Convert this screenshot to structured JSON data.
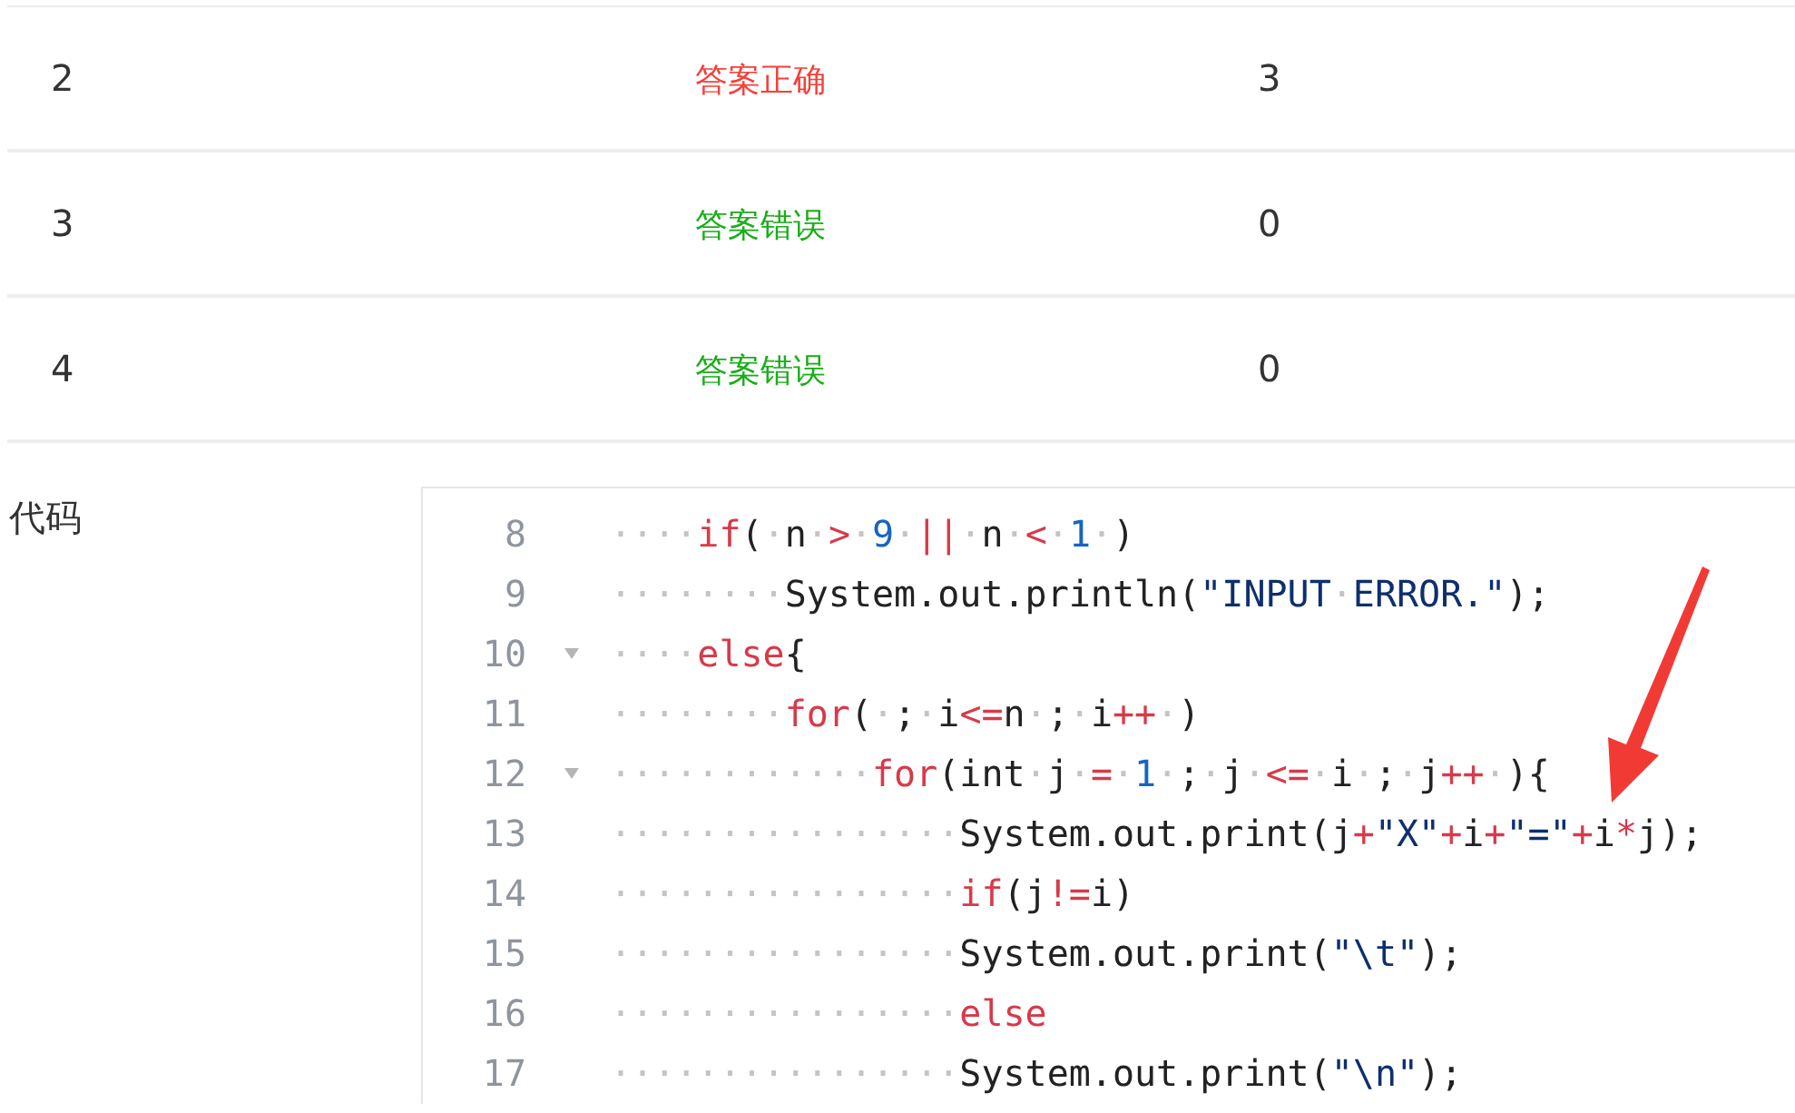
{
  "results": [
    {
      "number": "2",
      "result": "答案正确",
      "color": "#f5403a",
      "score": "3"
    },
    {
      "number": "3",
      "result": "答案错误",
      "color": "#1aad19",
      "score": "0"
    },
    {
      "number": "4",
      "result": "答案错误",
      "color": "#1aad19",
      "score": "0"
    }
  ],
  "code_label": "代码",
  "code_lines": [
    {
      "number": "8",
      "foldable": false,
      "tokens": [
        {
          "text": "····",
          "kind": "whitespace"
        },
        {
          "text": "if",
          "kind": "keyword"
        },
        {
          "text": "(",
          "kind": "plain"
        },
        {
          "text": "·",
          "kind": "whitespace"
        },
        {
          "text": "n",
          "kind": "plain"
        },
        {
          "text": "·",
          "kind": "whitespace"
        },
        {
          "text": ">",
          "kind": "operator"
        },
        {
          "text": "·",
          "kind": "whitespace"
        },
        {
          "text": "9",
          "kind": "number"
        },
        {
          "text": "·",
          "kind": "whitespace"
        },
        {
          "text": "||",
          "kind": "operator"
        },
        {
          "text": "·",
          "kind": "whitespace"
        },
        {
          "text": "n",
          "kind": "plain"
        },
        {
          "text": "·",
          "kind": "whitespace"
        },
        {
          "text": "<",
          "kind": "operator"
        },
        {
          "text": "·",
          "kind": "whitespace"
        },
        {
          "text": "1",
          "kind": "number"
        },
        {
          "text": "·",
          "kind": "whitespace"
        },
        {
          "text": ")",
          "kind": "plain"
        }
      ]
    },
    {
      "number": "9",
      "foldable": false,
      "tokens": [
        {
          "text": "········",
          "kind": "whitespace"
        },
        {
          "text": "System.out.println(",
          "kind": "plain"
        },
        {
          "text": "\"INPUT",
          "kind": "string"
        },
        {
          "text": "·",
          "kind": "whitespace"
        },
        {
          "text": "ERROR.\"",
          "kind": "string"
        },
        {
          "text": ");",
          "kind": "plain"
        }
      ]
    },
    {
      "number": "10",
      "foldable": true,
      "tokens": [
        {
          "text": "····",
          "kind": "whitespace"
        },
        {
          "text": "else",
          "kind": "keyword"
        },
        {
          "text": "{",
          "kind": "plain"
        }
      ]
    },
    {
      "number": "11",
      "foldable": false,
      "tokens": [
        {
          "text": "········",
          "kind": "whitespace"
        },
        {
          "text": "for",
          "kind": "keyword"
        },
        {
          "text": "(",
          "kind": "plain"
        },
        {
          "text": "·",
          "kind": "whitespace"
        },
        {
          "text": ";",
          "kind": "plain"
        },
        {
          "text": "·",
          "kind": "whitespace"
        },
        {
          "text": "i",
          "kind": "plain"
        },
        {
          "text": "<=",
          "kind": "operator"
        },
        {
          "text": "n",
          "kind": "plain"
        },
        {
          "text": "·",
          "kind": "whitespace"
        },
        {
          "text": ";",
          "kind": "plain"
        },
        {
          "text": "·",
          "kind": "whitespace"
        },
        {
          "text": "i",
          "kind": "plain"
        },
        {
          "text": "++",
          "kind": "operator"
        },
        {
          "text": "·",
          "kind": "whitespace"
        },
        {
          "text": ")",
          "kind": "plain"
        }
      ]
    },
    {
      "number": "12",
      "foldable": true,
      "tokens": [
        {
          "text": "············",
          "kind": "whitespace"
        },
        {
          "text": "for",
          "kind": "keyword"
        },
        {
          "text": "(int",
          "kind": "plain"
        },
        {
          "text": "·",
          "kind": "whitespace"
        },
        {
          "text": "j",
          "kind": "plain"
        },
        {
          "text": "·",
          "kind": "whitespace"
        },
        {
          "text": "=",
          "kind": "operator"
        },
        {
          "text": "·",
          "kind": "whitespace"
        },
        {
          "text": "1",
          "kind": "number"
        },
        {
          "text": "·",
          "kind": "whitespace"
        },
        {
          "text": ";",
          "kind": "plain"
        },
        {
          "text": "·",
          "kind": "whitespace"
        },
        {
          "text": "j",
          "kind": "plain"
        },
        {
          "text": "·",
          "kind": "whitespace"
        },
        {
          "text": "<=",
          "kind": "operator"
        },
        {
          "text": "·",
          "kind": "whitespace"
        },
        {
          "text": "i",
          "kind": "plain"
        },
        {
          "text": "·",
          "kind": "whitespace"
        },
        {
          "text": ";",
          "kind": "plain"
        },
        {
          "text": "·",
          "kind": "whitespace"
        },
        {
          "text": "j",
          "kind": "plain"
        },
        {
          "text": "++",
          "kind": "operator"
        },
        {
          "text": "·",
          "kind": "whitespace"
        },
        {
          "text": "){",
          "kind": "plain"
        }
      ]
    },
    {
      "number": "13",
      "foldable": false,
      "tokens": [
        {
          "text": "················",
          "kind": "whitespace"
        },
        {
          "text": "System.out.print(j",
          "kind": "plain"
        },
        {
          "text": "+",
          "kind": "operator"
        },
        {
          "text": "\"X\"",
          "kind": "string"
        },
        {
          "text": "+",
          "kind": "operator"
        },
        {
          "text": "i",
          "kind": "plain"
        },
        {
          "text": "+",
          "kind": "operator"
        },
        {
          "text": "\"=\"",
          "kind": "string"
        },
        {
          "text": "+",
          "kind": "operator"
        },
        {
          "text": "i",
          "kind": "plain"
        },
        {
          "text": "*",
          "kind": "operator"
        },
        {
          "text": "j);",
          "kind": "plain"
        }
      ]
    },
    {
      "number": "14",
      "foldable": false,
      "tokens": [
        {
          "text": "················",
          "kind": "whitespace"
        },
        {
          "text": "if",
          "kind": "keyword"
        },
        {
          "text": "(j",
          "kind": "plain"
        },
        {
          "text": "!=",
          "kind": "operator"
        },
        {
          "text": "i)",
          "kind": "plain"
        }
      ]
    },
    {
      "number": "15",
      "foldable": false,
      "tokens": [
        {
          "text": "················",
          "kind": "whitespace"
        },
        {
          "text": "System.out.print(",
          "kind": "plain"
        },
        {
          "text": "\"\\t\"",
          "kind": "string"
        },
        {
          "text": ");",
          "kind": "plain"
        }
      ]
    },
    {
      "number": "16",
      "foldable": false,
      "tokens": [
        {
          "text": "················",
          "kind": "whitespace"
        },
        {
          "text": "else",
          "kind": "keyword"
        }
      ]
    },
    {
      "number": "17",
      "foldable": false,
      "tokens": [
        {
          "text": "················",
          "kind": "whitespace"
        },
        {
          "text": "System.out.print(",
          "kind": "plain"
        },
        {
          "text": "\"\\n\"",
          "kind": "string"
        },
        {
          "text": ");",
          "kind": "plain"
        }
      ]
    }
  ]
}
